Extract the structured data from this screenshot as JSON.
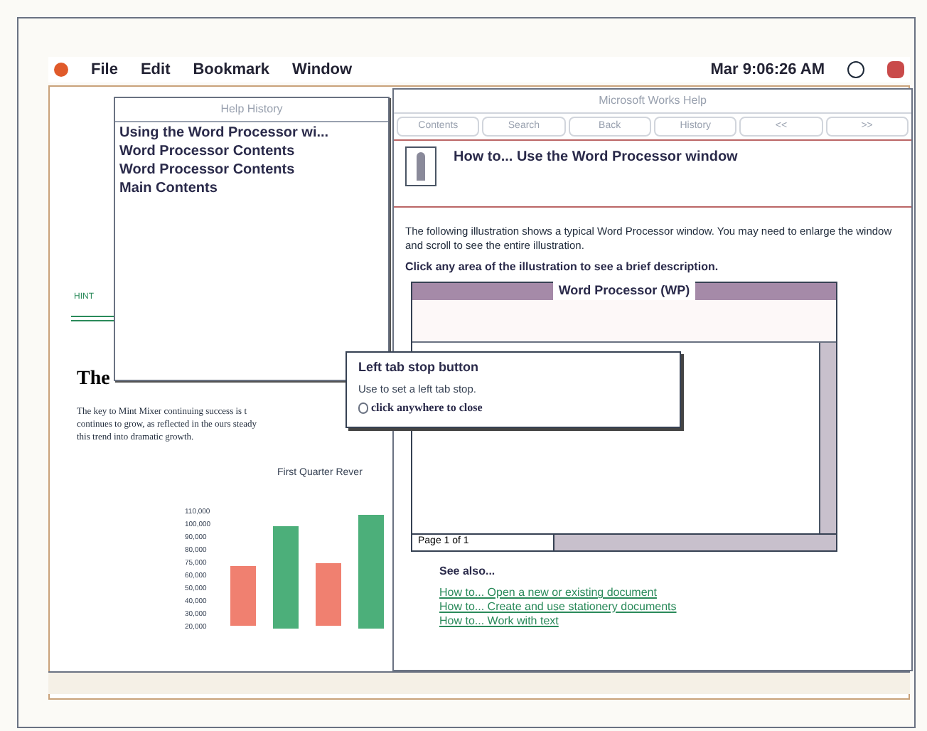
{
  "menubar": {
    "items": [
      "File",
      "Edit",
      "Bookmark",
      "Window"
    ],
    "clock": "Mar 9:06:26 AM"
  },
  "document": {
    "hint": "HINT",
    "heading": "The",
    "body": [
      "The key to Mint Mixer continuing success is t",
      "continues to grow, as reflected in the ours steady",
      "this trend into dramatic growth."
    ],
    "chart_title": "First Quarter Rever",
    "y_ticks": [
      "110,000",
      "100,000",
      "90,000",
      "80,000",
      "75,000",
      "60,000",
      "50,000",
      "40,000",
      "30,000",
      "20,000"
    ]
  },
  "history": {
    "title": "Help History",
    "items": [
      "Using the Word Processor wi...",
      "Word Processor Contents",
      "Word Processor Contents",
      "Main Contents"
    ]
  },
  "help": {
    "title": "Microsoft Works Help",
    "buttons": [
      {
        "label": "Contents",
        "disabled": true
      },
      {
        "label": "Search",
        "disabled": true
      },
      {
        "label": "Back",
        "disabled": true
      },
      {
        "label": "History",
        "disabled": true
      },
      {
        "label": "<<",
        "disabled": true
      },
      {
        "label": ">>",
        "disabled": true
      }
    ],
    "heading": "How to... Use the Word Processor window",
    "intro": "The following illustration shows a typical Word Processor window. You may need to enlarge the window and scroll to see the entire illustration.",
    "instruction": "Click any area of the illustration to see a brief description.",
    "see_also": "See also...",
    "links": [
      "How to... Open a new or existing document",
      "How to... Create and use stationery documents",
      "How to... Work with text"
    ]
  },
  "illustration": {
    "title": "Word Processor (WP)",
    "status": "Page 1 of 1"
  },
  "popup": {
    "title": "Left tab stop button",
    "text": "Use to set a left tab stop.",
    "close_hint": "click anywhere to close"
  }
}
